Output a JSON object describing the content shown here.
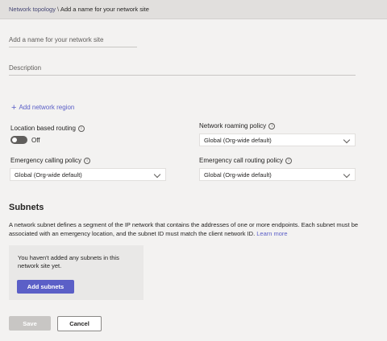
{
  "breadcrumb": {
    "parent": "Network topology",
    "separator": "\\",
    "current": "Add a name for your network site"
  },
  "form": {
    "name_placeholder": "Add a name for your network site",
    "description_placeholder": "Description",
    "add_region_label": "Add network region",
    "location_routing": {
      "label": "Location based routing",
      "state": "Off"
    },
    "network_roaming": {
      "label": "Network roaming policy",
      "value": "Global (Org-wide default)"
    },
    "emergency_calling": {
      "label": "Emergency calling policy",
      "value": "Global (Org-wide default)"
    },
    "emergency_call_routing": {
      "label": "Emergency call routing policy",
      "value": "Global (Org-wide default)"
    }
  },
  "subnets": {
    "title": "Subnets",
    "description": "A network subnet defines a segment of the IP network that contains the addresses of one or more endpoints. Each subnet must be associated with an emergency location, and the subnet ID must match the client network ID.",
    "learn_more": "Learn more",
    "empty_text": "You haven't added any subnets in this network site yet.",
    "add_button": "Add subnets"
  },
  "footer": {
    "save": "Save",
    "cancel": "Cancel"
  },
  "colors": {
    "accent": "#5b5fc7",
    "background": "#f3f2f1"
  }
}
